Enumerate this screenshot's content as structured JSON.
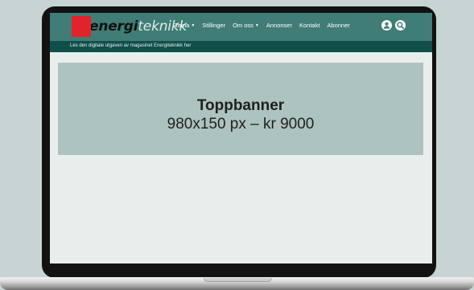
{
  "site": {
    "logo_bold": "energi",
    "logo_light": "teknikk"
  },
  "nav": {
    "items": [
      {
        "label": "Tema",
        "dropdown": true
      },
      {
        "label": "Stillinger",
        "dropdown": false
      },
      {
        "label": "Om oss",
        "dropdown": true
      },
      {
        "label": "Annonser",
        "dropdown": false
      },
      {
        "label": "Kontakt",
        "dropdown": false
      },
      {
        "label": "Abonner",
        "dropdown": false
      }
    ],
    "icons": [
      "user-icon",
      "search-icon"
    ]
  },
  "sub_bar": {
    "text": "Les den digitale utgaven av magasinet Energiteknikk her"
  },
  "banner": {
    "title": "Toppbanner",
    "subtitle": "980x150 px – kr 9000"
  },
  "colors": {
    "header": "#3f7d76",
    "sub_bar": "#0f4f4a",
    "banner": "#adc3c0",
    "logo_accent": "#e3232c",
    "background": "#c7d4d3"
  }
}
